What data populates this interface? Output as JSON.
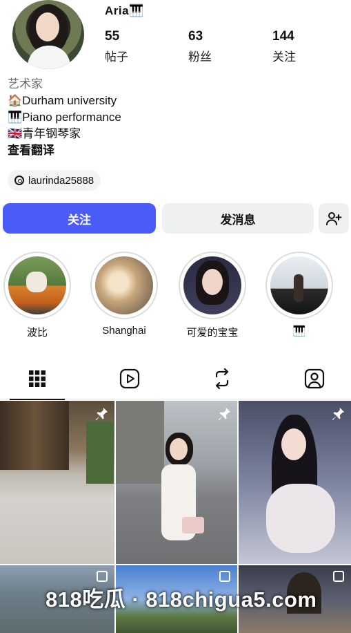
{
  "profile": {
    "username": "Aria🎹",
    "stats": [
      {
        "value": "55",
        "label": "帖子"
      },
      {
        "value": "63",
        "label": "粉丝"
      },
      {
        "value": "144",
        "label": "关注"
      }
    ],
    "bio": {
      "category": "艺术家",
      "line1": "🏠Durham university",
      "line2": "🎹Piano performance",
      "line3": "🇬🇧青年钢琴家",
      "translate_label": "查看翻译"
    },
    "threads_handle": "laurinda25888"
  },
  "actions": {
    "follow_label": "关注",
    "message_label": "发消息",
    "add_user_icon": "add-person-icon"
  },
  "highlights": [
    {
      "label": "波比"
    },
    {
      "label": "Shanghai"
    },
    {
      "label": "可爱的宝宝"
    },
    {
      "label": "🎹"
    }
  ],
  "tabs": {
    "active": "posts",
    "items": [
      "grid-icon",
      "reels-icon",
      "repost-icon",
      "tagged-icon"
    ]
  },
  "watermark": "818吃瓜 · 818chigua5.com",
  "colors": {
    "accent": "#4a5df9",
    "secondary_button": "#eff0f2"
  }
}
